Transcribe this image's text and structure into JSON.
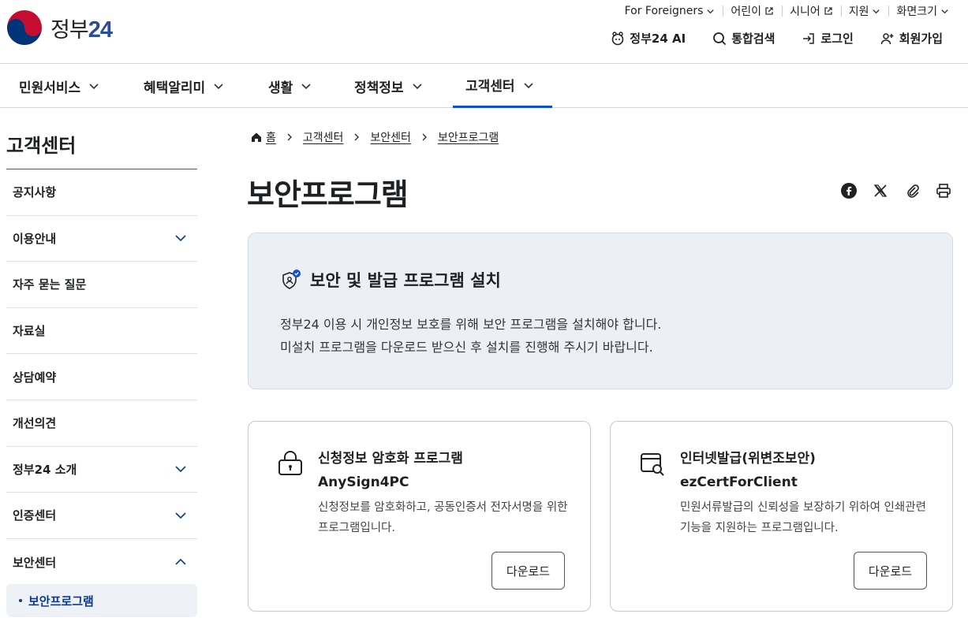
{
  "logo": {
    "text_kr": "정부",
    "text_num": "24"
  },
  "util_links": [
    {
      "label": "For Foreigners"
    },
    {
      "label": "어린이"
    },
    {
      "label": "시니어"
    },
    {
      "label": "지원"
    },
    {
      "label": "화면크기"
    }
  ],
  "gnb": {
    "ai": "정부24 AI",
    "search": "통합검색",
    "login": "로그인",
    "signup": "회원가입"
  },
  "main_nav": [
    "민원서비스",
    "혜택알리미",
    "생활",
    "정책정보",
    "고객센터"
  ],
  "sidebar": {
    "title": "고객센터",
    "items": [
      "공지사항",
      "이용안내",
      "자주 묻는 질문",
      "자료실",
      "상담예약",
      "개선의견",
      "정부24 소개",
      "인증센터",
      "보안센터"
    ],
    "sub_active": "보안프로그램"
  },
  "breadcrumb": {
    "home": "홈",
    "b1": "고객센터",
    "b2": "보안센터",
    "b3": "보안프로그램"
  },
  "page_title": "보안프로그램",
  "notice": {
    "title": "보안 및 발급 프로그램 설치",
    "line1": "정부24 이용 시 개인정보 보호를 위해 보안 프로그램을 설치해야 합니다.",
    "line2": "미설치 프로그램을 다운로드 받으신 후 설치를 진행해 주시기 바랍니다."
  },
  "cards": [
    {
      "title": "신청정보 암호화 프로그램",
      "name": "AnySign4PC",
      "desc": "신청정보를 암호화하고, 공동인증서 전자서명을 위한 프로그램입니다.",
      "button": "다운로드"
    },
    {
      "title": "인터넷발급(위변조보안)",
      "name": "ezCertForClient",
      "desc": "민원서류발급의 신뢰성을 보장하기 위하여 인쇄관련 기능을 지원하는 프로그램입니다.",
      "button": "다운로드"
    }
  ],
  "colors": {
    "accent": "#0b50d0",
    "notice_bg": "#ecf0f6",
    "active_sub": "#0b3b91"
  }
}
